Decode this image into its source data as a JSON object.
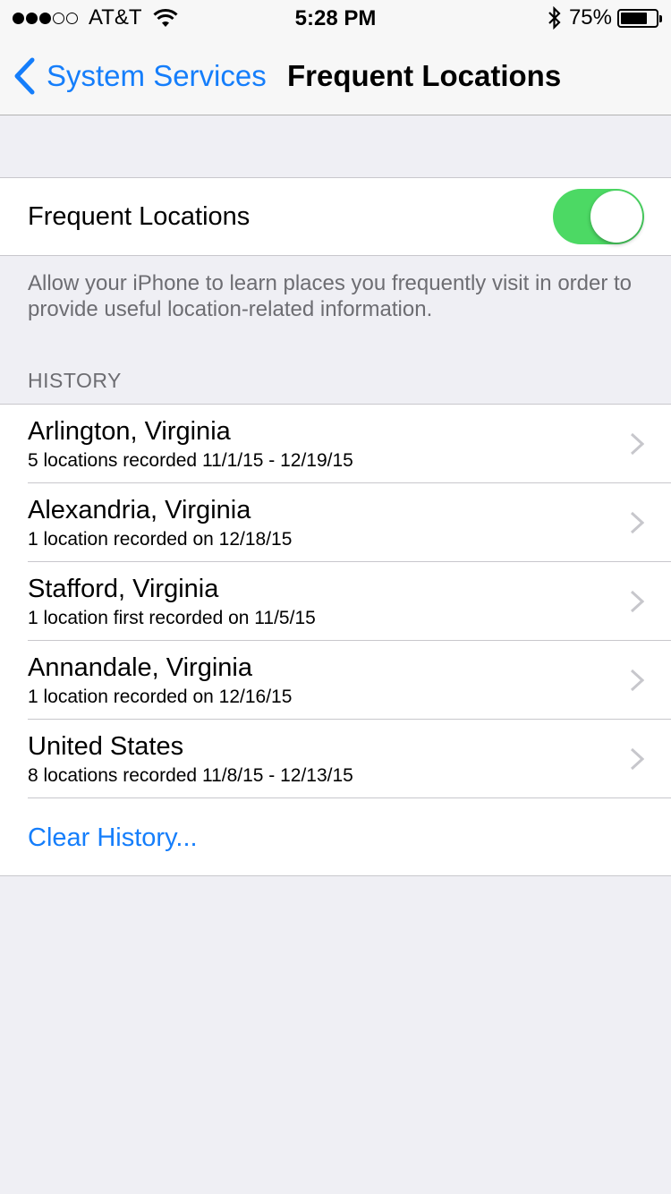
{
  "status_bar": {
    "carrier": "AT&T",
    "time": "5:28 PM",
    "battery_percent": "75%",
    "battery_level": 0.75,
    "signal_bars_filled": 3,
    "signal_bars_total": 5
  },
  "nav": {
    "back_label": "System Services",
    "title": "Frequent Locations"
  },
  "toggle": {
    "label": "Frequent Locations",
    "on": true,
    "on_color": "#4cd964"
  },
  "description": "Allow your iPhone to learn places you frequently visit in order to provide useful location-related information.",
  "history": {
    "header": "HISTORY",
    "items": [
      {
        "title": "Arlington, Virginia",
        "subtitle": "5 locations recorded 11/1/15 - 12/19/15"
      },
      {
        "title": "Alexandria, Virginia",
        "subtitle": "1 location recorded on 12/18/15"
      },
      {
        "title": "Stafford, Virginia",
        "subtitle": "1 location first recorded on 11/5/15"
      },
      {
        "title": "Annandale, Virginia",
        "subtitle": "1 location recorded on 12/16/15"
      },
      {
        "title": "United States",
        "subtitle": "8 locations recorded 11/8/15 - 12/13/15"
      }
    ],
    "clear_label": "Clear History..."
  },
  "colors": {
    "accent": "#157efb",
    "background": "#efeff4"
  }
}
